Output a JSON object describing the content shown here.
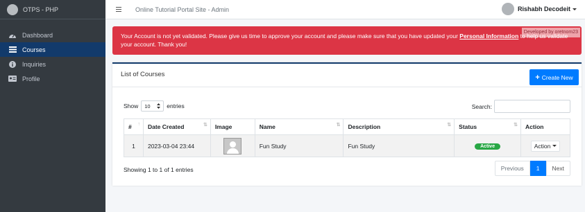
{
  "brand": {
    "text": "OTPS - PHP"
  },
  "sidebar": {
    "items": [
      {
        "label": "Dashboard",
        "icon": "dashboard-icon",
        "active": false
      },
      {
        "label": "Courses",
        "icon": "list-icon",
        "active": true
      },
      {
        "label": "Inquiries",
        "icon": "info-icon",
        "active": false
      },
      {
        "label": "Profile",
        "icon": "id-card-icon",
        "active": false
      }
    ]
  },
  "topbar": {
    "site_title": "Online Tutorial Portal Site - Admin",
    "user_name": "Rishabh Decodeit"
  },
  "alert": {
    "text_before": "Your Account is not yet validated. Please give us time to approve your account and please make sure that you have updated your ",
    "link_text": "Personal Information",
    "text_after": " to help us validate your account. Thank you!",
    "watermark": "Developed by oretnom23"
  },
  "card": {
    "title": "List of Courses",
    "create_button": "Create New",
    "show_label": "Show",
    "entries_value": "10",
    "entries_label": "entries",
    "search_label": "Search:"
  },
  "table": {
    "columns": [
      "#",
      "Date Created",
      "Image",
      "Name",
      "Description",
      "Status",
      "Action"
    ],
    "rows": [
      {
        "index": "1",
        "date_created": "2023-03-04 23:44",
        "name": "Fun Study",
        "description": "Fun Study",
        "status": "Active",
        "action": "Action"
      }
    ]
  },
  "footer": {
    "info": "Showing 1 to 1 of 1 entries",
    "prev": "Previous",
    "current_page": "1",
    "next": "Next"
  },
  "colors": {
    "sidebar_bg": "#343a40",
    "active_nav": "#123a6b",
    "alert_bg": "#dc3545",
    "primary": "#007bff",
    "status_active": "#28a745"
  }
}
